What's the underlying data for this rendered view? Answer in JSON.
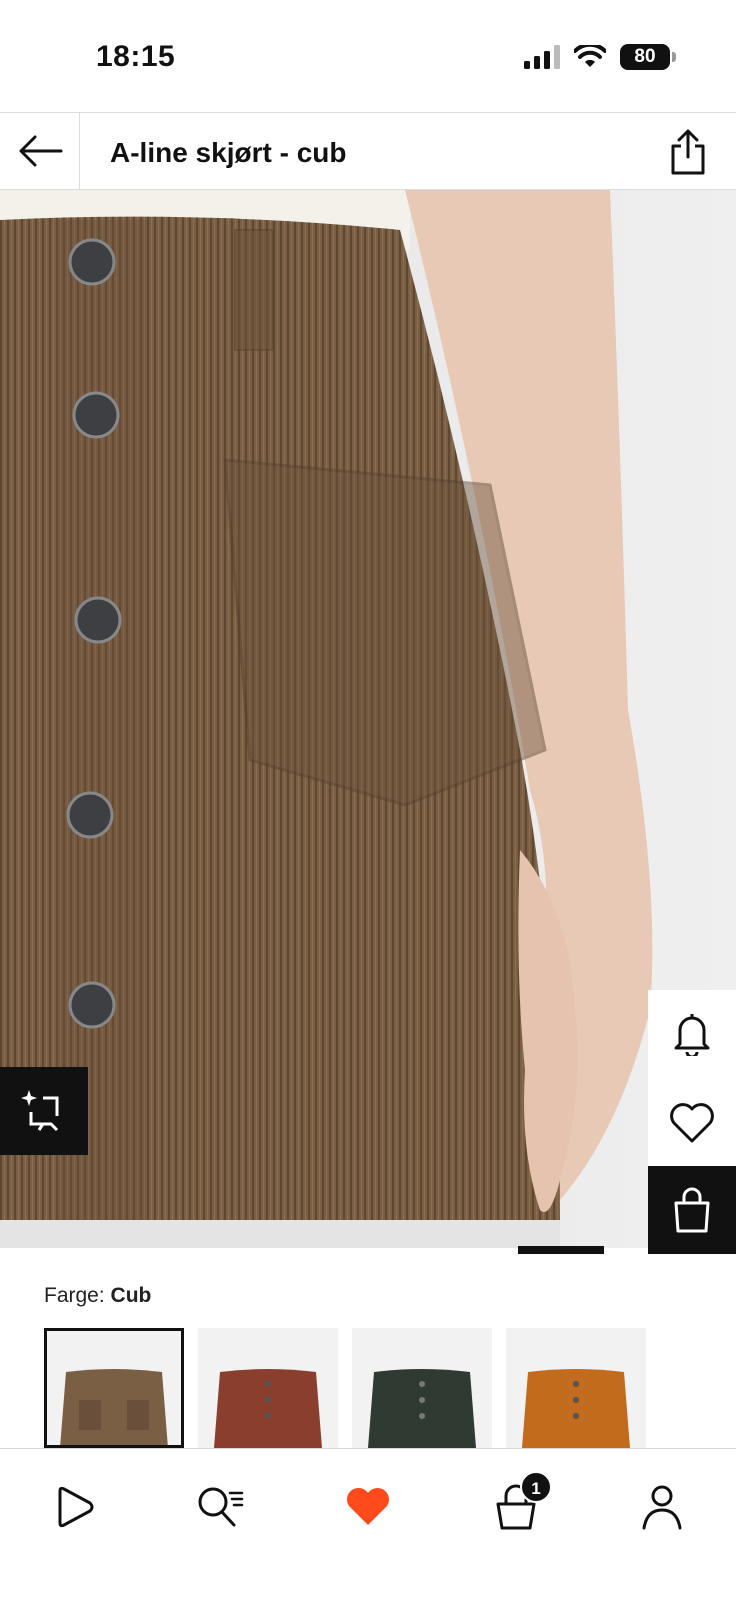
{
  "status_bar": {
    "time": "18:15",
    "battery": "80"
  },
  "header": {
    "title": "A-line skjørt - cub"
  },
  "colors": {
    "label": "Farge:",
    "selected": "Cub",
    "swatches": [
      {
        "name": "Cub",
        "color": "#7a5f44"
      },
      {
        "name": "Rust",
        "color": "#8a3e2e"
      },
      {
        "name": "Dark green",
        "color": "#2e3a32"
      },
      {
        "name": "Orange",
        "color": "#c26b1c"
      }
    ]
  },
  "cart": {
    "count": "1"
  },
  "theme": {
    "accent": "#ff4a1c",
    "dark": "#111111"
  }
}
